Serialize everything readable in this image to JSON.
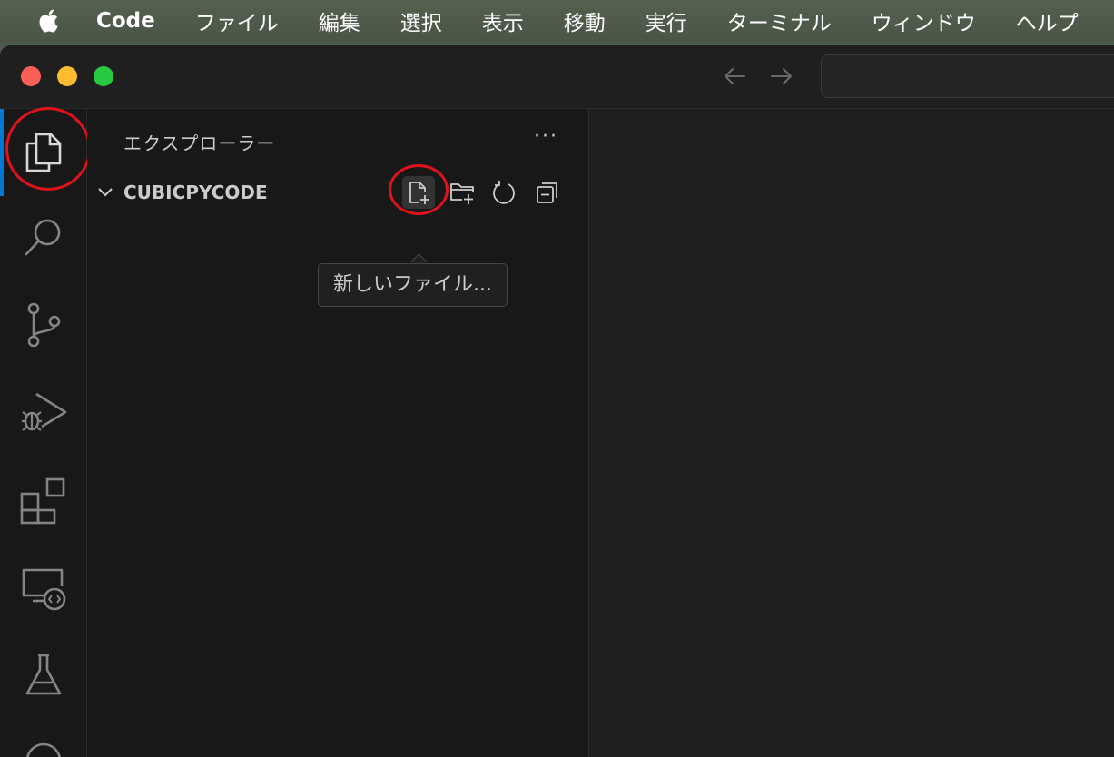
{
  "menubar": {
    "app_name": "Code",
    "items": [
      "ファイル",
      "編集",
      "選択",
      "表示",
      "移動",
      "実行",
      "ターミナル",
      "ウィンドウ",
      "ヘルプ"
    ]
  },
  "activity_bar": {
    "icons": [
      "explorer-icon",
      "search-icon",
      "source-control-icon",
      "run-debug-icon",
      "extensions-icon",
      "remote-explorer-icon",
      "testing-icon",
      "accounts-icon"
    ],
    "active": "explorer-icon"
  },
  "sidebar": {
    "title": "エクスプローラー",
    "more": "···",
    "folder": {
      "name": "CUBICPYCODE",
      "expanded": true
    },
    "toolbar": [
      "new-file-icon",
      "new-folder-icon",
      "refresh-icon",
      "collapse-all-icon"
    ]
  },
  "tooltip": {
    "text": "新しいファイル..."
  },
  "colors": {
    "accent": "#0078d4",
    "annotation": "#e0121c",
    "background": "#181818"
  }
}
